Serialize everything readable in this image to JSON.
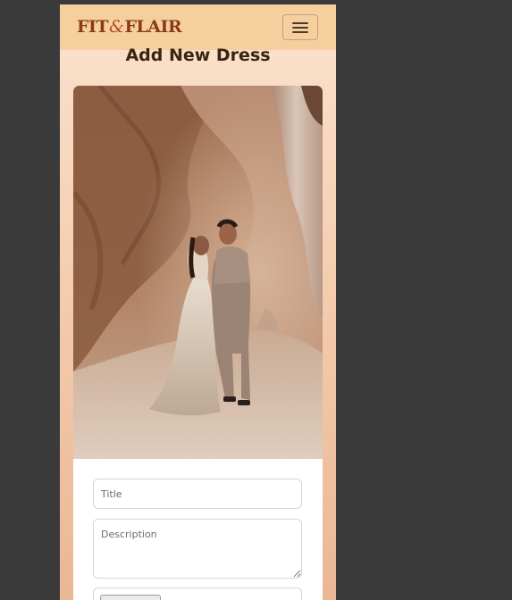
{
  "navbar": {
    "brand_left": "FIT",
    "brand_amp": "&",
    "brand_right": "FLAIR",
    "menu_icon": "hamburger-menu-icon"
  },
  "page": {
    "heading": "Add New Dress"
  },
  "form": {
    "image_description": "photo",
    "title_placeholder": "Title",
    "title_value": "",
    "description_placeholder": "Description",
    "description_value": ""
  },
  "colors": {
    "navbar_bg": "#f6cf9f",
    "brand": "#8a3a16",
    "heading": "#3a2412",
    "page_bg_top": "#fbe3cf",
    "page_bg_bottom": "#eab796",
    "outer_bg": "#3a3a3a"
  }
}
